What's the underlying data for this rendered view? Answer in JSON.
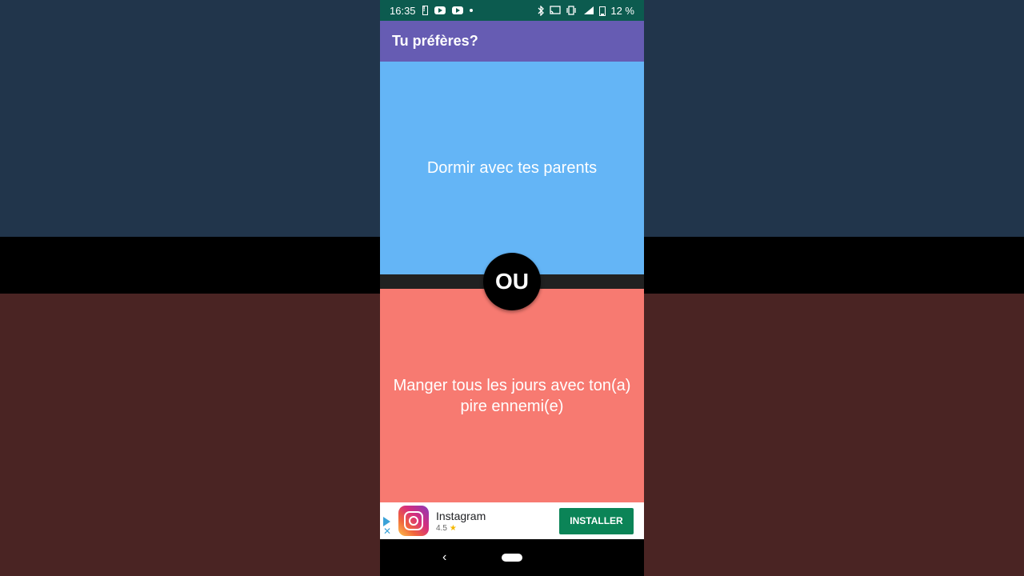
{
  "status_bar": {
    "time": "16:35",
    "battery": "12 %",
    "icons": [
      "battery-alert-icon",
      "youtube-icon",
      "youtube-icon",
      "dot-icon",
      "bluetooth-icon",
      "cast-icon",
      "vibrate-icon",
      "signal-4g-icon",
      "battery-icon"
    ]
  },
  "app_bar": {
    "title": "Tu préfères?"
  },
  "question": {
    "option_a": "Dormir avec tes parents",
    "option_b": "Manger tous les jours avec ton(a) pire ennemi(e)",
    "separator": "OU"
  },
  "ad": {
    "app_name": "Instagram",
    "rating": "4.5",
    "install_label": "INSTALLER",
    "close_glyph": "✕"
  },
  "nav": {
    "back_glyph": "‹"
  },
  "colors": {
    "status_bar": "#0c5b4f",
    "app_bar": "#665cb3",
    "option_a_bg": "#64b5f6",
    "option_b_bg": "#f77a71",
    "install_button": "#0b8457"
  }
}
